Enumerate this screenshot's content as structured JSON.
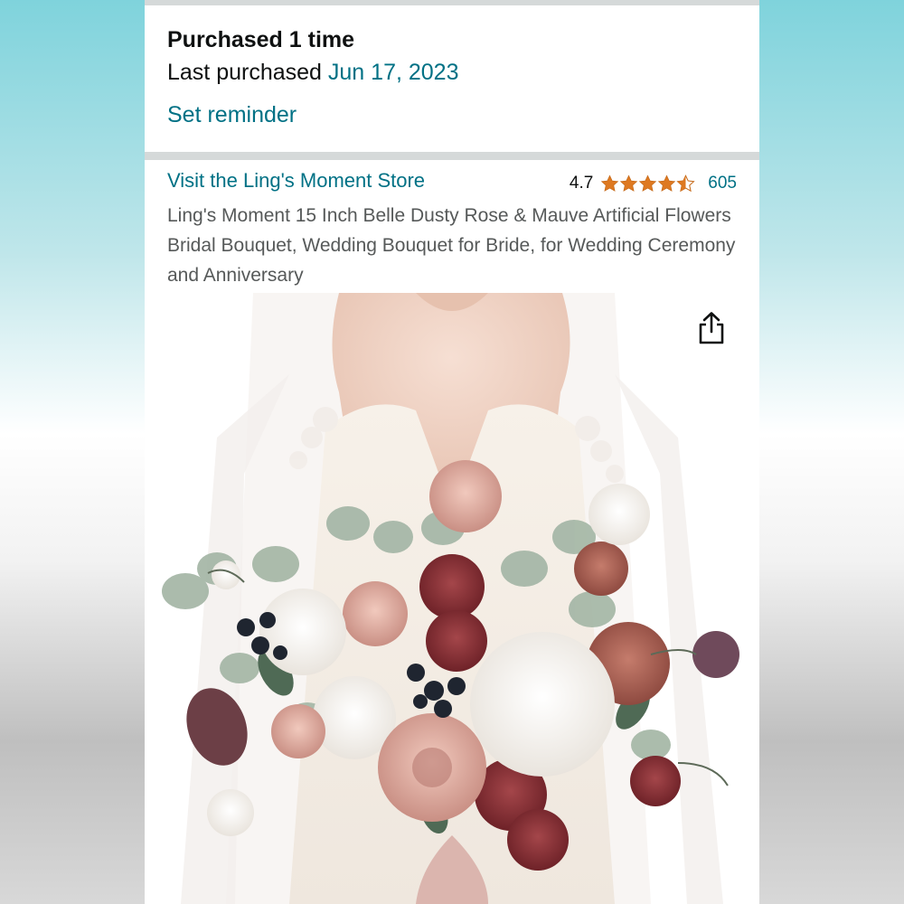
{
  "purchase": {
    "count_label": "Purchased 1 time",
    "last_label": "Last purchased",
    "last_date": "Jun 17, 2023",
    "reminder_label": "Set reminder"
  },
  "product": {
    "store_link": "Visit the Ling's Moment Store",
    "rating": "4.7",
    "rating_stars": 4.7,
    "review_count": "605",
    "title": "Ling's Moment 15 Inch Belle Dusty Rose & Mauve Artificial Flowers Bridal Bouquet, Wedding Bouquet for Bride, for Wedding Ceremony and Anniversary"
  },
  "icons": {
    "share": "share-icon",
    "star": "star-icon"
  },
  "colors": {
    "link": "#007185",
    "star": "#de7921",
    "text": "#0f1111",
    "muted": "#565959",
    "divider": "#d5d9d9"
  }
}
